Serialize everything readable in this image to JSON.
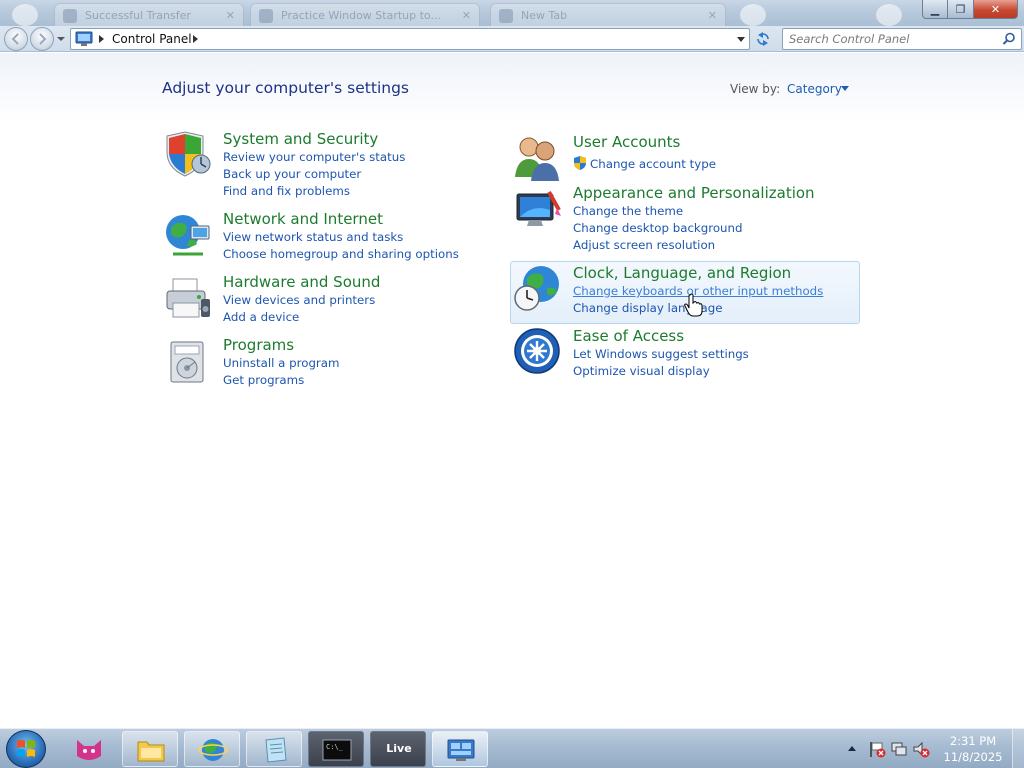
{
  "window": {
    "background_tabs": [
      "Successful Transfer",
      "Practice Window Startup to...",
      "New Tab"
    ]
  },
  "navbar": {
    "breadcrumb": "Control Panel",
    "search_placeholder": "Search Control Panel"
  },
  "header": {
    "title": "Adjust your computer's settings",
    "view_by_label": "View by:",
    "view_by_value": "Category"
  },
  "categories": {
    "system_security": {
      "title": "System and Security",
      "links": [
        "Review your computer's status",
        "Back up your computer",
        "Find and fix problems"
      ]
    },
    "network_internet": {
      "title": "Network and Internet",
      "links": [
        "View network status and tasks",
        "Choose homegroup and sharing options"
      ]
    },
    "hardware_sound": {
      "title": "Hardware and Sound",
      "links": [
        "View devices and printers",
        "Add a device"
      ]
    },
    "programs": {
      "title": "Programs",
      "links": [
        "Uninstall a program",
        "Get programs"
      ]
    },
    "user_accounts": {
      "title": "User Accounts",
      "links": [
        "Change account type"
      ]
    },
    "appearance": {
      "title": "Appearance and Personalization",
      "links": [
        "Change the theme",
        "Change desktop background",
        "Adjust screen resolution"
      ]
    },
    "clock_region": {
      "title": "Clock, Language, and Region",
      "links": [
        "Change keyboards or other input methods",
        "Change display language"
      ]
    },
    "ease_access": {
      "title": "Ease of Access",
      "links": [
        "Let Windows suggest settings",
        "Optimize visual display"
      ]
    }
  },
  "taskbar": {
    "live_label": "Live",
    "clock_time": "2:31 PM",
    "clock_date": "11/8/2025"
  },
  "colors": {
    "category_title": "#1d7b2e",
    "link": "#1e56b0",
    "page_title": "#1e3287"
  }
}
